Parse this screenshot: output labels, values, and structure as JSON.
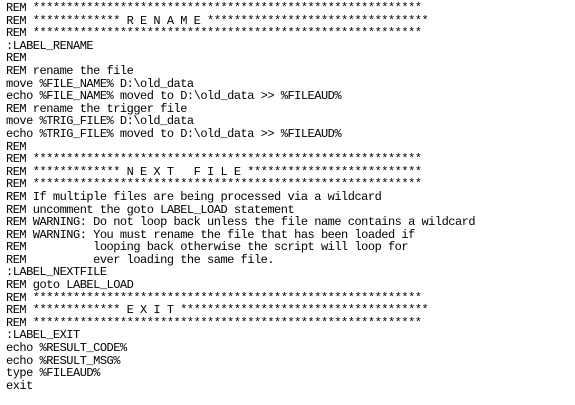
{
  "lines": [
    "REM **********************************************************",
    "REM ************* R E N A M E *********************************",
    "REM **********************************************************",
    ":LABEL_RENAME",
    "REM",
    "REM rename the file",
    "move %FILE_NAME% D:\\old_data",
    "echo %FILE_NAME% moved to D:\\old_data >> %FILEAUD%",
    "REM rename the trigger file",
    "move %TRIG_FILE% D:\\old_data",
    "echo %TRIG_FILE% moved to D:\\old_data >> %FILEAUD%",
    "REM",
    "REM **********************************************************",
    "REM ************* N E X T   F I L E **************************",
    "REM **********************************************************",
    "REM If multiple files are being processed via a wildcard",
    "REM uncomment the goto LABEL_LOAD statement",
    "REM WARNING: Do not loop back unless the file name contains a wildcard",
    "REM WARNING: You must rename the file that has been loaded if",
    "REM          looping back otherwise the script will loop for",
    "REM          ever loading the same file.",
    ":LABEL_NEXTFILE",
    "REM goto LABEL_LOAD",
    "REM **********************************************************",
    "REM ************* E X I T *************************************",
    "REM **********************************************************",
    ":LABEL_EXIT",
    "echo %RESULT_CODE%",
    "echo %RESULT_MSG%",
    "type %FILEAUD%",
    "exit"
  ]
}
